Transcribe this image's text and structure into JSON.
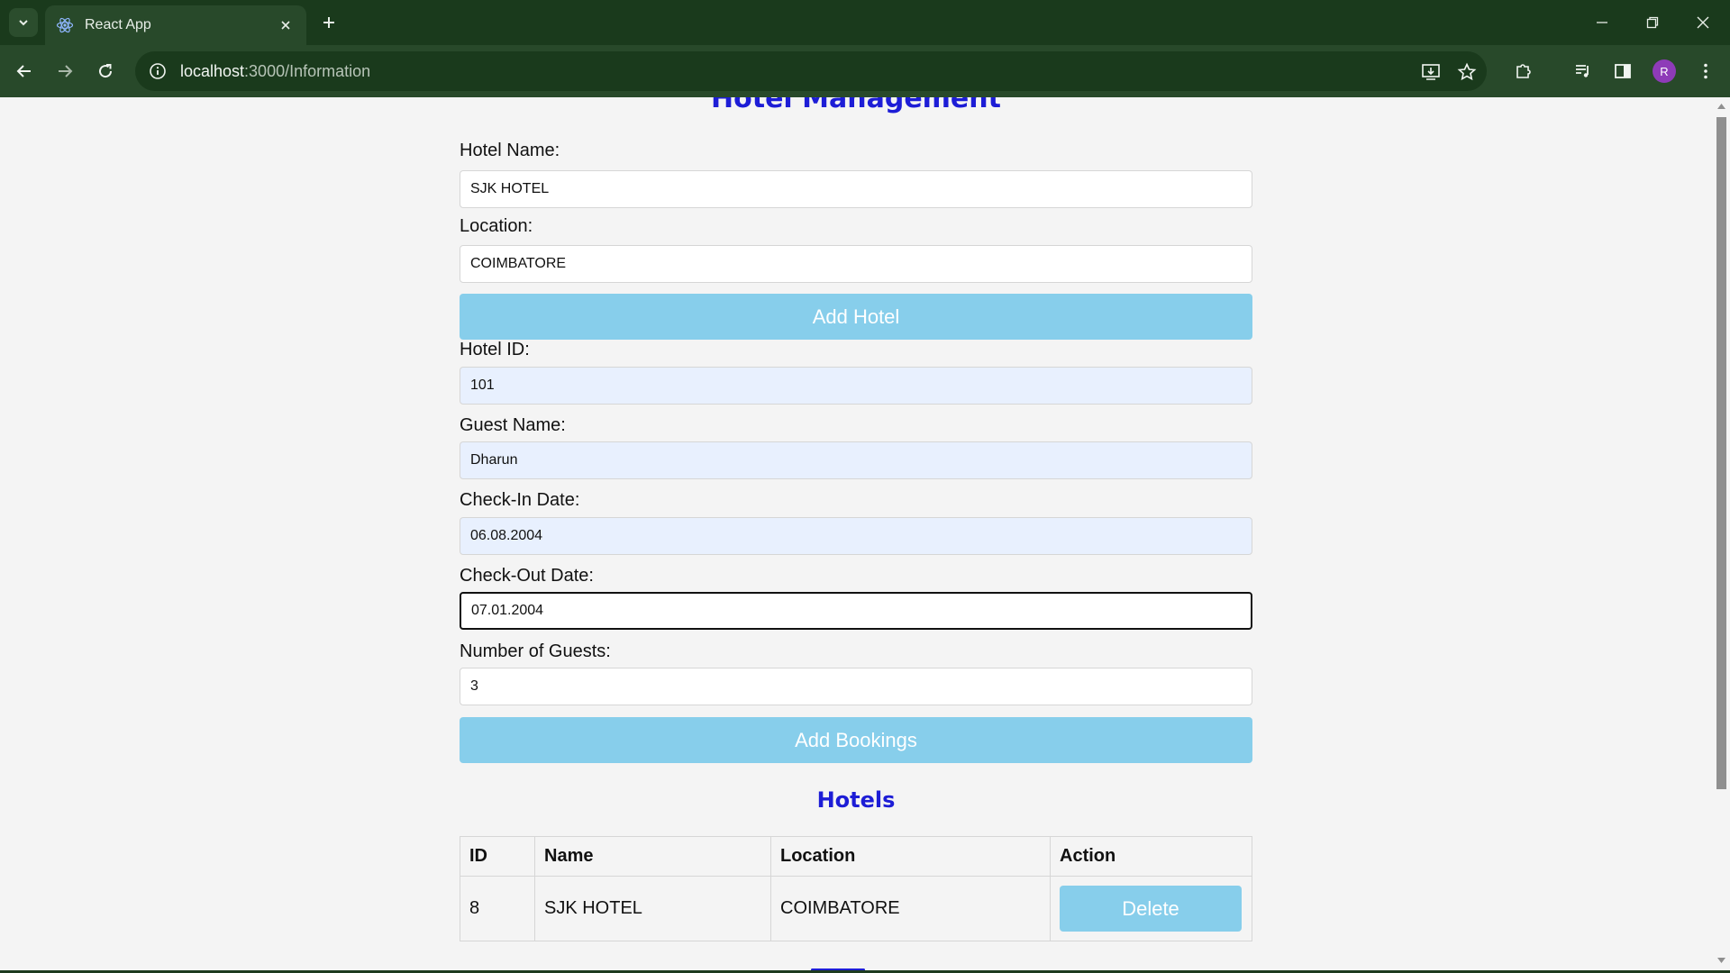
{
  "browser": {
    "tab_title": "React App",
    "url_host": "localhost",
    "url_path": ":3000/Information",
    "profile_initial": "R"
  },
  "page": {
    "heading": "Hotel Management",
    "hotel_form": {
      "name_label": "Hotel Name:",
      "name_value": "SJK HOTEL",
      "location_label": "Location:",
      "location_value": "COIMBATORE",
      "submit_label": "Add Hotel"
    },
    "booking_form": {
      "hotel_id_label": "Hotel ID:",
      "hotel_id_value": "101",
      "guest_name_label": "Guest Name:",
      "guest_name_value": "Dharun",
      "check_in_label": "Check-In Date:",
      "check_in_value": "06.08.2004",
      "check_out_label": "Check-Out Date:",
      "check_out_value": "07.01.2004",
      "guests_label": "Number of Guests:",
      "guests_value": "3",
      "submit_label": "Add Bookings"
    },
    "hotels_section": {
      "title": "Hotels",
      "columns": [
        "ID",
        "Name",
        "Location",
        "Action"
      ],
      "rows": [
        {
          "id": "8",
          "name": "SJK HOTEL",
          "location": "COIMBATORE",
          "action": "Delete"
        }
      ]
    }
  },
  "colors": {
    "accent_button": "#87ceeb",
    "heading_blue": "#1d1dd6",
    "chrome_dark": "#1a3a1c",
    "chrome_toolbar": "#28492a"
  }
}
